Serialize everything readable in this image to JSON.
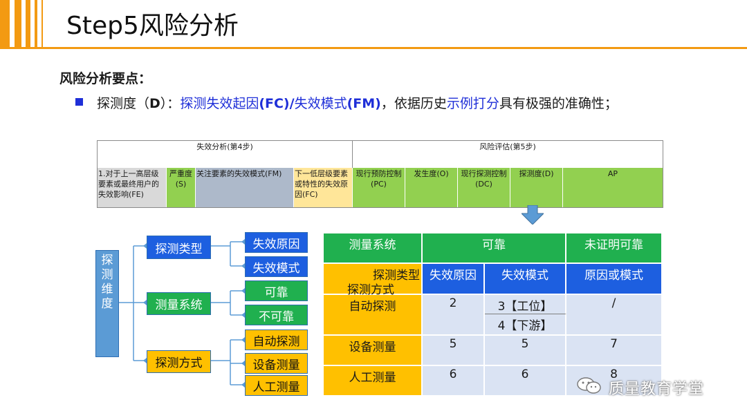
{
  "header": {
    "title": "Step5风险分析"
  },
  "section": {
    "heading": "风险分析要点：",
    "bullet": {
      "prefix": "探测度（",
      "d": "D",
      "mid": "）：",
      "blue1": "探测失效起因",
      "fc": "(FC)/",
      "blue2": "失效模式",
      "fm": "(FM)",
      "text2": "，依据历史",
      "blue3": "示例打分",
      "text3": "具有极强的准确性；"
    }
  },
  "fmea": {
    "group1": "失效分析(第4步)",
    "group2": "风险评估(第5步)",
    "columns": [
      "1.对于上一高层级要素或最终用户的失效影响(FE)",
      "严重度(S)",
      "关注要素的失效模式(FM)",
      "下一低层级要素或特性的失效原因(FC)",
      "现行预防控制(PC)",
      "发生度(O)",
      "现行探测控制(DC)",
      "探测度(D)",
      "AP"
    ],
    "colors": {
      "grey": "#d9d9d9",
      "green": "#92d050",
      "blue_grey": "#adb9ca",
      "yellow": "#ffe699"
    }
  },
  "tree": {
    "root": "探测维度",
    "branches": [
      {
        "label": "探测类型",
        "children": [
          "失效原因",
          "失效模式"
        ]
      },
      {
        "label": "测量系统",
        "children": [
          "可靠",
          "不可靠"
        ]
      },
      {
        "label": "探测方式",
        "children": [
          "自动探测",
          "设备测量",
          "人工测量"
        ]
      }
    ]
  },
  "table": {
    "header_row": {
      "c1": "测量系统",
      "c2": "可靠",
      "c3": "未证明可靠"
    },
    "diag_top": "探测类型",
    "diag_bottom": "探测方式",
    "sub": {
      "c2": "失效原因",
      "c3": "失效模式",
      "c4": "原因或模式"
    },
    "rows": [
      {
        "label": "自动探测",
        "v1": "2",
        "v2a": "3【工位】",
        "v2b": "4【下游】",
        "v3": "/"
      },
      {
        "label": "设备测量",
        "v1": "5",
        "v2": "5",
        "v3": "7"
      },
      {
        "label": "人工测量",
        "v1": "6",
        "v2": "6",
        "v3": "8"
      }
    ],
    "colors": {
      "green": "#20b04f",
      "yellow": "#ffc000",
      "blue": "#1d5fe0",
      "cell": "#dae3f3"
    }
  },
  "watermark": {
    "text": "质量教育学堂",
    "icon": "wechat-icon"
  }
}
